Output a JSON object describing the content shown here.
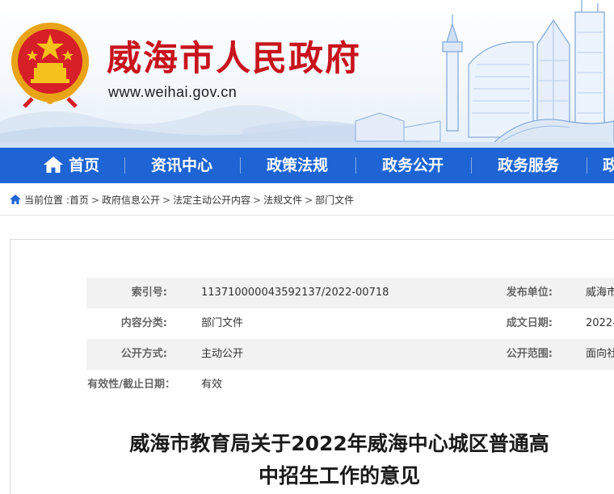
{
  "header": {
    "site_title": "威海市人民政府",
    "site_url": "www.weihai.gov.cn",
    "title_color": "#c8141c",
    "emblem_icon": "national-emblem-icon"
  },
  "nav": {
    "background_color": "#1f64d4",
    "items": [
      {
        "label": "首页",
        "icon": "home-icon"
      },
      {
        "label": "资讯中心"
      },
      {
        "label": "政策法规"
      },
      {
        "label": "政务公开"
      },
      {
        "label": "政务服务"
      },
      {
        "label": "政"
      }
    ]
  },
  "breadcrumb": {
    "prefix": "当前位置 :",
    "icon": "location-icon",
    "items": [
      "首页",
      "政府信息公开",
      "法定主动公开内容",
      "法规文件",
      "部门文件"
    ],
    "separator": ">"
  },
  "meta": {
    "rows": [
      {
        "label": "索引号:",
        "value": "113710000043592137/2022-00718",
        "label2": "发布单位:",
        "value2": "威海市"
      },
      {
        "label": "内容分类:",
        "value": "部门文件",
        "label2": "成文日期:",
        "value2": "2022-"
      },
      {
        "label": "公开方式:",
        "value": "主动公开",
        "label2": "公开范围:",
        "value2": "面向社"
      },
      {
        "label": "有效性/截止日期：",
        "value": "有效"
      }
    ]
  },
  "article": {
    "title_line1": "威海市教育局关于2022年威海中心城区普通高",
    "title_line2": "中招生工作的意见"
  }
}
